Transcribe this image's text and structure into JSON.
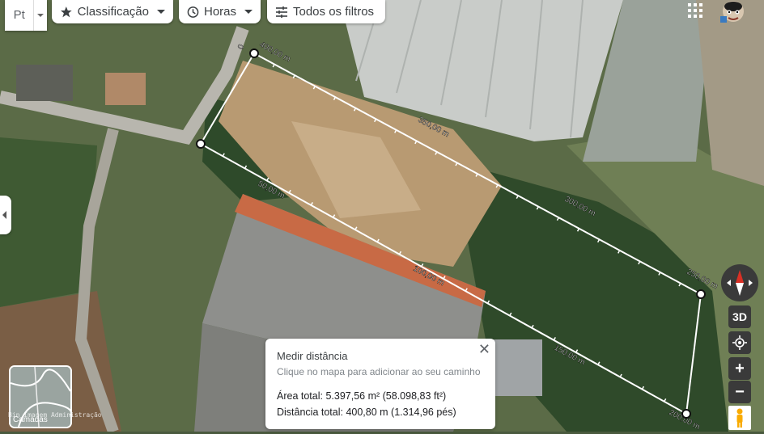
{
  "toolbar": {
    "distance_type": "Pt",
    "filters": [
      {
        "label": "Classificação",
        "icon": "star-icon"
      },
      {
        "label": "Horas",
        "icon": "clock-icon"
      },
      {
        "label": "Todos os filtros",
        "icon": "sliders-icon"
      }
    ]
  },
  "map": {
    "segments": [
      {
        "label": "400,00 m"
      },
      {
        "label": "350,00 m"
      },
      {
        "label": "300,00 m"
      },
      {
        "label": "250,00 m"
      },
      {
        "label": "200,00 m"
      },
      {
        "label": "150,00 m"
      },
      {
        "label": "100,00 m"
      },
      {
        "label": "50,00 m"
      },
      {
        "label": "0"
      }
    ],
    "minimap_label": "Camadas",
    "attribution": "Bin Imagem Administração"
  },
  "controls": {
    "view_3d": "3D",
    "zoom_in": "+",
    "zoom_out": "−"
  },
  "measure_panel": {
    "title": "Medir distância",
    "hint": "Clique no mapa para adicionar ao seu caminho",
    "area": "Área total: 5.397,56 m² (58.098,83 ft²)",
    "distance": "Distância total: 400,80 m (1.314,96 pés)"
  },
  "colors": {
    "measure_line": "#ffffff",
    "control_bg": "#3a3a3a",
    "compass_red": "#d93025"
  }
}
